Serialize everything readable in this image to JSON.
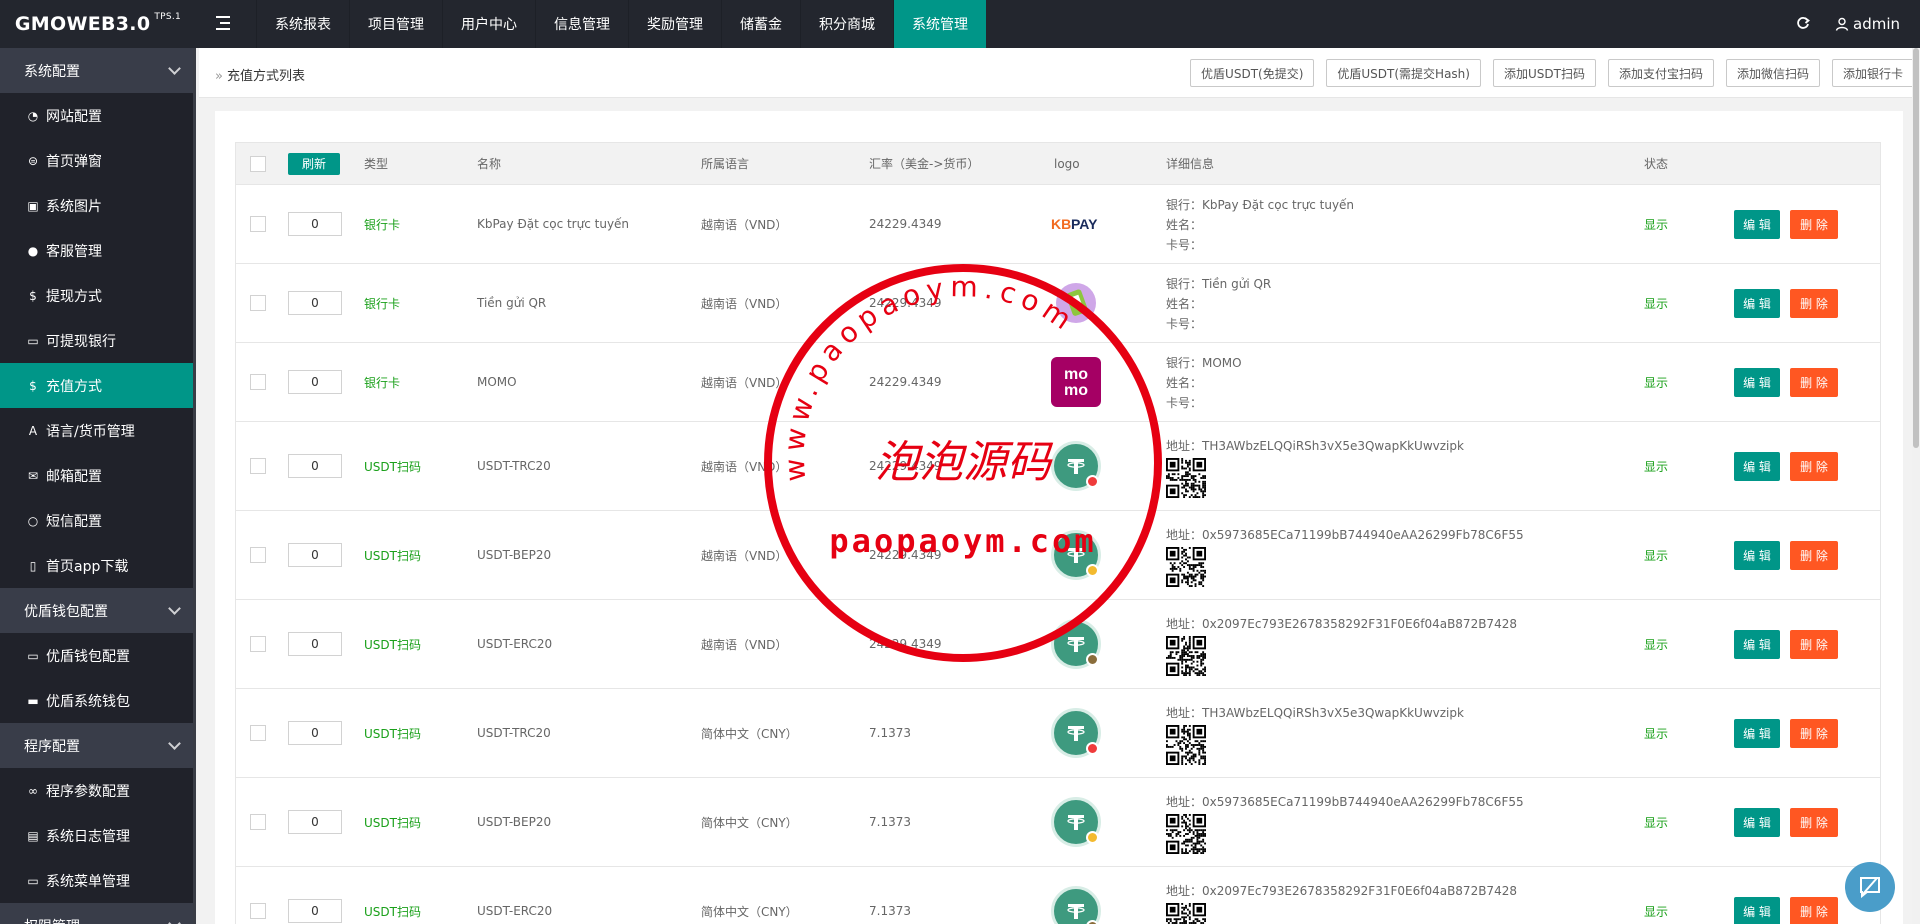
{
  "brand": {
    "name": "GMOWEB3.0",
    "version": "TPS.1"
  },
  "topnav": [
    {
      "label": "系统报表"
    },
    {
      "label": "项目管理"
    },
    {
      "label": "用户中心"
    },
    {
      "label": "信息管理"
    },
    {
      "label": "奖励管理"
    },
    {
      "label": "储蓄金"
    },
    {
      "label": "积分商城"
    },
    {
      "label": "系统管理",
      "active": true
    }
  ],
  "user": {
    "name": "admin"
  },
  "sidebar": {
    "groups": [
      {
        "label": "系统配置",
        "items": [
          {
            "label": "网站配置",
            "icon": "dashboard-icon"
          },
          {
            "label": "首页弹窗",
            "icon": "popup-icon"
          },
          {
            "label": "系统图片",
            "icon": "image-icon"
          },
          {
            "label": "客服管理",
            "icon": "chat-icon"
          },
          {
            "label": "提现方式",
            "icon": "dollar-icon"
          },
          {
            "label": "可提现银行",
            "icon": "card-icon"
          },
          {
            "label": "充值方式",
            "icon": "dollar-icon",
            "active": true
          },
          {
            "label": "语言/货币管理",
            "icon": "font-icon"
          },
          {
            "label": "邮箱配置",
            "icon": "mail-icon"
          },
          {
            "label": "短信配置",
            "icon": "message-icon"
          },
          {
            "label": "首页app下载",
            "icon": "mobile-icon"
          }
        ]
      },
      {
        "label": "优盾钱包配置",
        "items": [
          {
            "label": "优盾钱包配置",
            "icon": "card-icon"
          },
          {
            "label": "优盾系统钱包",
            "icon": "wallet-icon"
          }
        ]
      },
      {
        "label": "程序配置",
        "items": [
          {
            "label": "程序参数配置",
            "icon": "link-icon"
          },
          {
            "label": "系统日志管理",
            "icon": "log-icon"
          },
          {
            "label": "系统菜单管理",
            "icon": "menu-icon"
          }
        ]
      },
      {
        "label": "权限管理",
        "items": []
      }
    ]
  },
  "breadcrumb": {
    "title": "充值方式列表"
  },
  "actions": [
    {
      "label": "优盾USDT(免提交)"
    },
    {
      "label": "优盾USDT(需提交Hash)"
    },
    {
      "label": "添加USDT扫码"
    },
    {
      "label": "添加支付宝扫码"
    },
    {
      "label": "添加微信扫码"
    },
    {
      "label": "添加银行卡"
    }
  ],
  "table": {
    "refresh_label": "刷新",
    "columns": {
      "type": "类型",
      "name": "名称",
      "lang": "所属语言",
      "rate": "汇率（美金->货币）",
      "logo": "logo",
      "detail": "详细信息",
      "status": "状态"
    },
    "edit_label": "编 辑",
    "delete_label": "删 除",
    "rows": [
      {
        "sort": "0",
        "type": "银行卡",
        "name": "KbPay Đặt cọc trực tuyến",
        "lang": "越南语（VND）",
        "rate": "24229.4349",
        "logo": "kbpay",
        "detail": [
          "银行：KbPay Đặt cọc trực tuyến",
          "姓名：",
          "卡号："
        ],
        "qr": false,
        "status": "显示"
      },
      {
        "sort": "0",
        "type": "银行卡",
        "name": "Tiền gửi QR",
        "lang": "越南语（VND）",
        "rate": "24229.4349",
        "logo": "qrpay",
        "detail": [
          "银行：Tiền gửi QR",
          "姓名：",
          "卡号："
        ],
        "qr": false,
        "status": "显示"
      },
      {
        "sort": "0",
        "type": "银行卡",
        "name": "MOMO",
        "lang": "越南语（VND）",
        "rate": "24229.4349",
        "logo": "momo",
        "detail": [
          "银行：MOMO",
          "姓名：",
          "卡号："
        ],
        "qr": false,
        "status": "显示"
      },
      {
        "sort": "0",
        "type": "USDT扫码",
        "name": "USDT-TRC20",
        "lang": "越南语（VND）",
        "rate": "24229.4349",
        "logo": "usdt-trc",
        "detail": [
          "地址：TH3AWbzELQQiRSh3vX5e3QwapKkUwvzipk"
        ],
        "qr": true,
        "status": "显示"
      },
      {
        "sort": "0",
        "type": "USDT扫码",
        "name": "USDT-BEP20",
        "lang": "越南语（VND）",
        "rate": "24229.4349",
        "logo": "usdt-bep",
        "detail": [
          "地址：0x5973685ECa71199bB744940eAA26299Fb78C6F55"
        ],
        "qr": true,
        "status": "显示"
      },
      {
        "sort": "0",
        "type": "USDT扫码",
        "name": "USDT-ERC20",
        "lang": "越南语（VND）",
        "rate": "24229.4349",
        "logo": "usdt-erc",
        "detail": [
          "地址：0x2097Ec793E2678358292F31F0E6f04aB872B7428"
        ],
        "qr": true,
        "status": "显示"
      },
      {
        "sort": "0",
        "type": "USDT扫码",
        "name": "USDT-TRC20",
        "lang": "简体中文（CNY）",
        "rate": "7.1373",
        "logo": "usdt-trc",
        "detail": [
          "地址：TH3AWbzELQQiRSh3vX5e3QwapKkUwvzipk"
        ],
        "qr": true,
        "status": "显示"
      },
      {
        "sort": "0",
        "type": "USDT扫码",
        "name": "USDT-BEP20",
        "lang": "简体中文（CNY）",
        "rate": "7.1373",
        "logo": "usdt-bep",
        "detail": [
          "地址：0x5973685ECa71199bB744940eAA26299Fb78C6F55"
        ],
        "qr": true,
        "status": "显示"
      },
      {
        "sort": "0",
        "type": "USDT扫码",
        "name": "USDT-ERC20",
        "lang": "简体中文（CNY）",
        "rate": "7.1373",
        "logo": "usdt-erc",
        "detail": [
          "地址：0x2097Ec793E2678358292F31F0E6f04aB872B7428"
        ],
        "qr": true,
        "status": "显示"
      }
    ]
  },
  "watermark": {
    "top_text": "www.paopaoym.com",
    "center_text": "泡泡源码",
    "bottom_text": "paopaoym.com"
  },
  "colors": {
    "accent": "#009688",
    "danger": "#ff5722",
    "sidebar_bg": "#20222a",
    "topbar_bg": "#23262e",
    "stamp_red": "#e60012",
    "usdt_green": "#3e9a7f"
  }
}
